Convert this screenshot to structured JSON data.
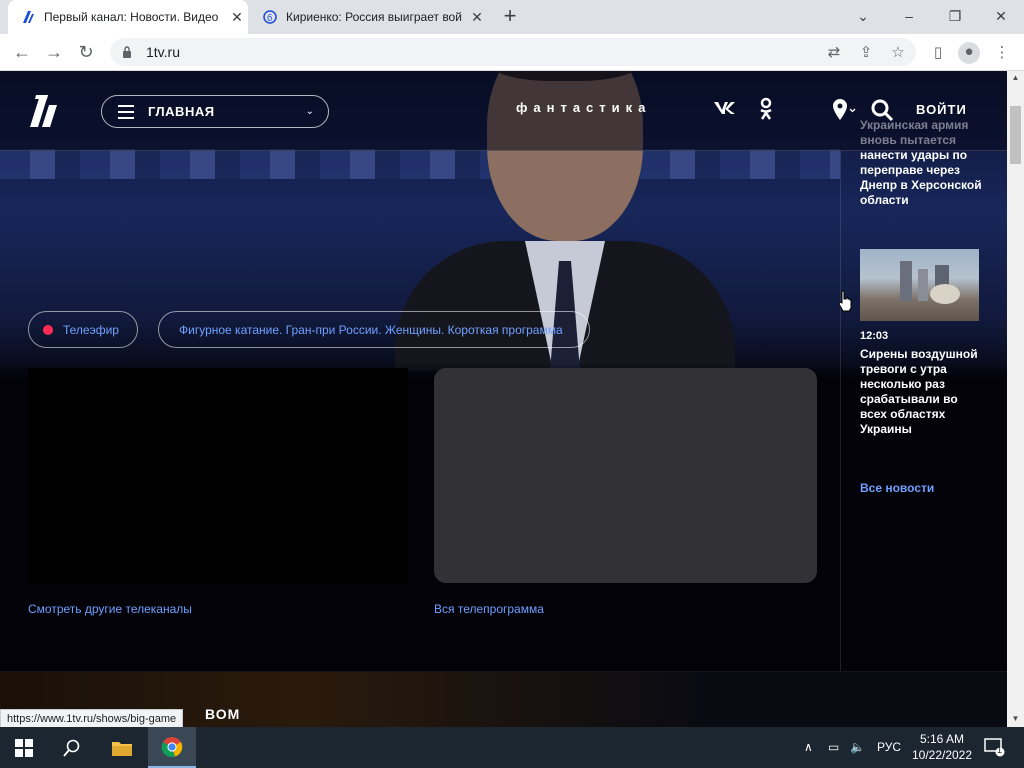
{
  "browser": {
    "tabs": [
      {
        "title": "Первый канал: Новости. Видео",
        "active": true
      },
      {
        "title": "Кириенко: Россия выиграет вой",
        "active": false
      }
    ],
    "new_tab": "+",
    "url": "1tv.ru",
    "window_controls": {
      "minimize": "–",
      "restore": "❐",
      "close": "✕"
    },
    "chevron": "⌄"
  },
  "site": {
    "menu_label": "ГЛАВНАЯ",
    "promo": "фантастика",
    "vk": "vk",
    "login": "ВОЙТИ"
  },
  "live": {
    "chip_live": "Телеэфир",
    "chip_program": "Фигурное катание. Гран-при России. Женщины. Короткая программа",
    "link_other_channels": "Смотреть другие телеканалы",
    "link_schedule": "Вся телепрограмма"
  },
  "news": {
    "prev_faded": "Украинская армия вновь пытается",
    "prev_title": "нанести удары по переправе через Днепр в Херсонской области",
    "time": "12:03",
    "title": "Сирены воздушной тревоги с утра несколько раз срабатывали во всех областях Украины",
    "all_news": "Все новости"
  },
  "bottom": {
    "word": "ВОМ",
    "status_url": "https://www.1tv.ru/shows/big-game"
  },
  "taskbar": {
    "lang": "РУС",
    "time": "5:16 AM",
    "date": "10/22/2022",
    "notif_count": "1"
  },
  "colors": {
    "accent_link": "#6fa0ff",
    "live_dot": "#ff2d55"
  }
}
